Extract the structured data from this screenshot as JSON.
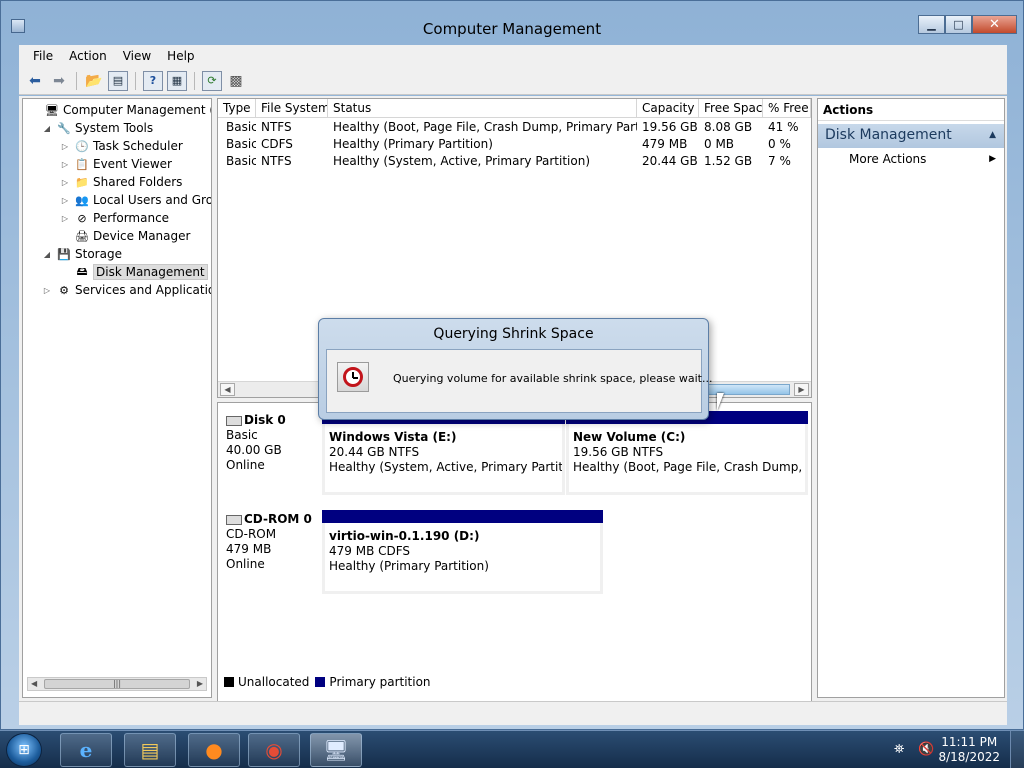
{
  "window": {
    "title": "Computer Management"
  },
  "title_buttons": {
    "minimize": "▁",
    "maximize": "□",
    "close": "✕"
  },
  "menu": [
    "File",
    "Action",
    "View",
    "Help"
  ],
  "toolbar_icons": [
    "back-arrow-icon",
    "forward-arrow-icon",
    "up-folder-icon",
    "show-hide-tree-icon",
    "help-icon",
    "properties-icon",
    "refresh-icon",
    "export-list-icon"
  ],
  "tree": [
    {
      "label": "Computer Management (Local",
      "level": 0,
      "expander": "",
      "icon": "computer-icon",
      "glyph": "🖥"
    },
    {
      "label": "System Tools",
      "level": 1,
      "expander": "◢",
      "icon": "system-tools-icon",
      "glyph": "🔧"
    },
    {
      "label": "Task Scheduler",
      "level": 2,
      "expander": "▷",
      "icon": "clock-icon",
      "glyph": "🕒"
    },
    {
      "label": "Event Viewer",
      "level": 2,
      "expander": "▷",
      "icon": "event-viewer-icon",
      "glyph": "📋"
    },
    {
      "label": "Shared Folders",
      "level": 2,
      "expander": "▷",
      "icon": "shared-folder-icon",
      "glyph": "📁"
    },
    {
      "label": "Local Users and Groups",
      "level": 2,
      "expander": "▷",
      "icon": "users-icon",
      "glyph": "👥"
    },
    {
      "label": "Performance",
      "level": 2,
      "expander": "▷",
      "icon": "performance-icon",
      "glyph": "⊘"
    },
    {
      "label": "Device Manager",
      "level": 2,
      "expander": "",
      "icon": "device-manager-icon",
      "glyph": "🖨"
    },
    {
      "label": "Storage",
      "level": 1,
      "expander": "◢",
      "icon": "storage-icon",
      "glyph": "💾"
    },
    {
      "label": "Disk Management",
      "level": 2,
      "expander": "",
      "icon": "disk-icon",
      "glyph": "🖴",
      "selected": true
    },
    {
      "label": "Services and Applications",
      "level": 1,
      "expander": "▷",
      "icon": "services-icon",
      "glyph": "⚙"
    }
  ],
  "volumes": {
    "columns": [
      "Type",
      "File System",
      "Status",
      "Capacity",
      "Free Space",
      "% Free"
    ],
    "rows": [
      [
        "Basic",
        "NTFS",
        "Healthy (Boot, Page File, Crash Dump, Primary Partition)",
        "19.56 GB",
        "8.08 GB",
        "41 %"
      ],
      [
        "Basic",
        "CDFS",
        "Healthy (Primary Partition)",
        "479 MB",
        "0 MB",
        "0 %"
      ],
      [
        "Basic",
        "NTFS",
        "Healthy (System, Active, Primary Partition)",
        "20.44 GB",
        "1.52 GB",
        "7 %"
      ]
    ]
  },
  "disks": [
    {
      "name": "Disk 0",
      "kind": "Basic",
      "size": "40.00 GB",
      "state": "Online",
      "partitions": [
        {
          "name": "Windows Vista  (E:)",
          "size": "20.44 GB NTFS",
          "status": "Healthy (System, Active, Primary Partition)"
        },
        {
          "name": "New Volume  (C:)",
          "size": "19.56 GB NTFS",
          "status": "Healthy (Boot, Page File, Crash Dump, Prim"
        }
      ]
    },
    {
      "name": "CD-ROM 0",
      "kind": "CD-ROM",
      "size": "479 MB",
      "state": "Online",
      "partitions": [
        {
          "name": "virtio-win-0.1.190  (D:)",
          "size": "479 MB CDFS",
          "status": "Healthy (Primary Partition)"
        }
      ]
    }
  ],
  "legend": {
    "unallocated": "Unallocated",
    "primary": "Primary partition"
  },
  "colors": {
    "primary_partition": "#000080",
    "unallocated": "#000000"
  },
  "actions": {
    "header": "Actions",
    "group": "Disk Management",
    "items": [
      "More Actions"
    ]
  },
  "dialog": {
    "title": "Querying Shrink Space",
    "message": "Querying volume for available shrink space, please wait..."
  },
  "taskbar": {
    "apps": [
      "internet-explorer-icon",
      "file-explorer-icon",
      "firefox-icon",
      "control-panel-icon",
      "computer-management-icon"
    ],
    "time": "11:11 PM",
    "date": "8/18/2022"
  }
}
